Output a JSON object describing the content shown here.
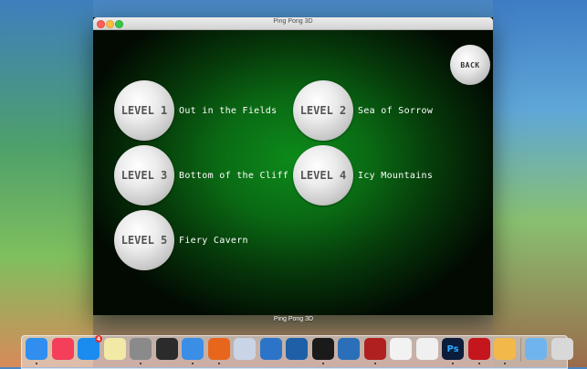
{
  "window": {
    "title": "Ping Pong 3D"
  },
  "caption": "Ping Pong 3D",
  "back_label": "BACK",
  "levels": [
    {
      "badge": "LEVEL 1",
      "name": "Out in the Fields"
    },
    {
      "badge": "LEVEL 2",
      "name": "Sea of Sorrow"
    },
    {
      "badge": "LEVEL 3",
      "name": "Bottom of the Cliff"
    },
    {
      "badge": "LEVEL 4",
      "name": "Icy Mountains"
    },
    {
      "badge": "LEVEL 5",
      "name": "Fiery Cavern"
    }
  ],
  "dock": {
    "app_store_badge": "4",
    "photoshop_label": "Ps",
    "apps": [
      {
        "icon": "finder-icon",
        "color": "#2f8ef0"
      },
      {
        "icon": "itunes-icon",
        "color": "#f43e5a"
      },
      {
        "icon": "app-store-icon",
        "color": "#1a8cf0"
      },
      {
        "icon": "notes-icon",
        "color": "#f3e9a6"
      },
      {
        "icon": "system-preferences-icon",
        "color": "#8a8a8a"
      },
      {
        "icon": "activity-monitor-icon",
        "color": "#2b2b2b"
      },
      {
        "icon": "safari-icon",
        "color": "#3a8ee6"
      },
      {
        "icon": "firefox-icon",
        "color": "#e8661c"
      },
      {
        "icon": "preview-icon",
        "color": "#c9d4e6"
      },
      {
        "icon": "xcode-icon",
        "color": "#2c74c8"
      },
      {
        "icon": "virtualbox-icon",
        "color": "#1f5fa8"
      },
      {
        "icon": "terminal-icon",
        "color": "#1a1a1a"
      },
      {
        "icon": "wireshark-icon",
        "color": "#2a6fb8"
      },
      {
        "icon": "photo-booth-icon",
        "color": "#b02020"
      },
      {
        "icon": "photos-icon",
        "color": "#f2f2f2"
      },
      {
        "icon": "textedit-icon",
        "color": "#f0f0f0"
      },
      {
        "icon": "photoshop-icon",
        "color": "#0b1d3a"
      },
      {
        "icon": "flash-icon",
        "color": "#c4161c"
      },
      {
        "icon": "game-icon",
        "color": "#f2b84a"
      },
      {
        "icon": "downloads-folder-icon",
        "color": "#6fb4ec"
      },
      {
        "icon": "trash-icon",
        "color": "#d8d8d8"
      }
    ]
  }
}
